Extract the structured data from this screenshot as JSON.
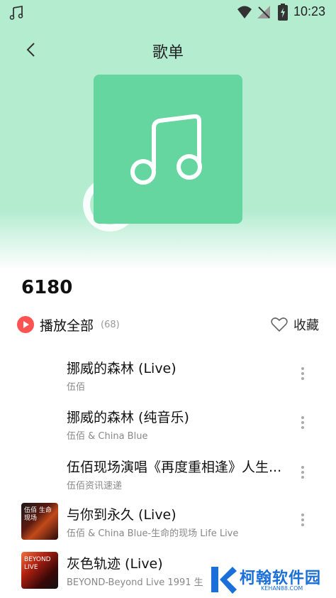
{
  "status_bar": {
    "time": "10:23",
    "icons": [
      "music-note-icon",
      "wifi-icon",
      "no-sim-icon",
      "battery-charging-icon"
    ]
  },
  "header": {
    "title": "歌单",
    "back_icon": "chevron-left-icon"
  },
  "playlist": {
    "name": "6180",
    "cover_icon": "music-note-icon",
    "cover_color": "#66d6a0",
    "hero_color": "#b4ecd0"
  },
  "actions": {
    "play_all_label": "播放全部",
    "play_all_count": "(68)",
    "favorite_label": "收藏",
    "accent_color": "#ff5252"
  },
  "songs": [
    {
      "title": "挪威的森林 (Live)",
      "subtitle": "伍佰",
      "has_thumb": false
    },
    {
      "title": "挪威的森林 (纯音乐)",
      "subtitle": "伍佰 & China Blue",
      "has_thumb": false
    },
    {
      "title": "伍佰现场演唱《再度重相逢》人生...",
      "subtitle": "伍佰资讯速递",
      "has_thumb": false
    },
    {
      "title": "与你到永久 (Live)",
      "subtitle": "伍佰 & China Blue-生命的现场 Life Live",
      "has_thumb": true,
      "thumb_text": "伍佰 生命 现场"
    },
    {
      "title": "灰色轨迹 (Live)",
      "subtitle": "BEYOND-Beyond Live 1991 生",
      "has_thumb": true,
      "thumb_text": "BEYOND LIVE"
    }
  ],
  "watermark": {
    "text": "柯翰软件园",
    "url": "KEHAN88.COM"
  }
}
